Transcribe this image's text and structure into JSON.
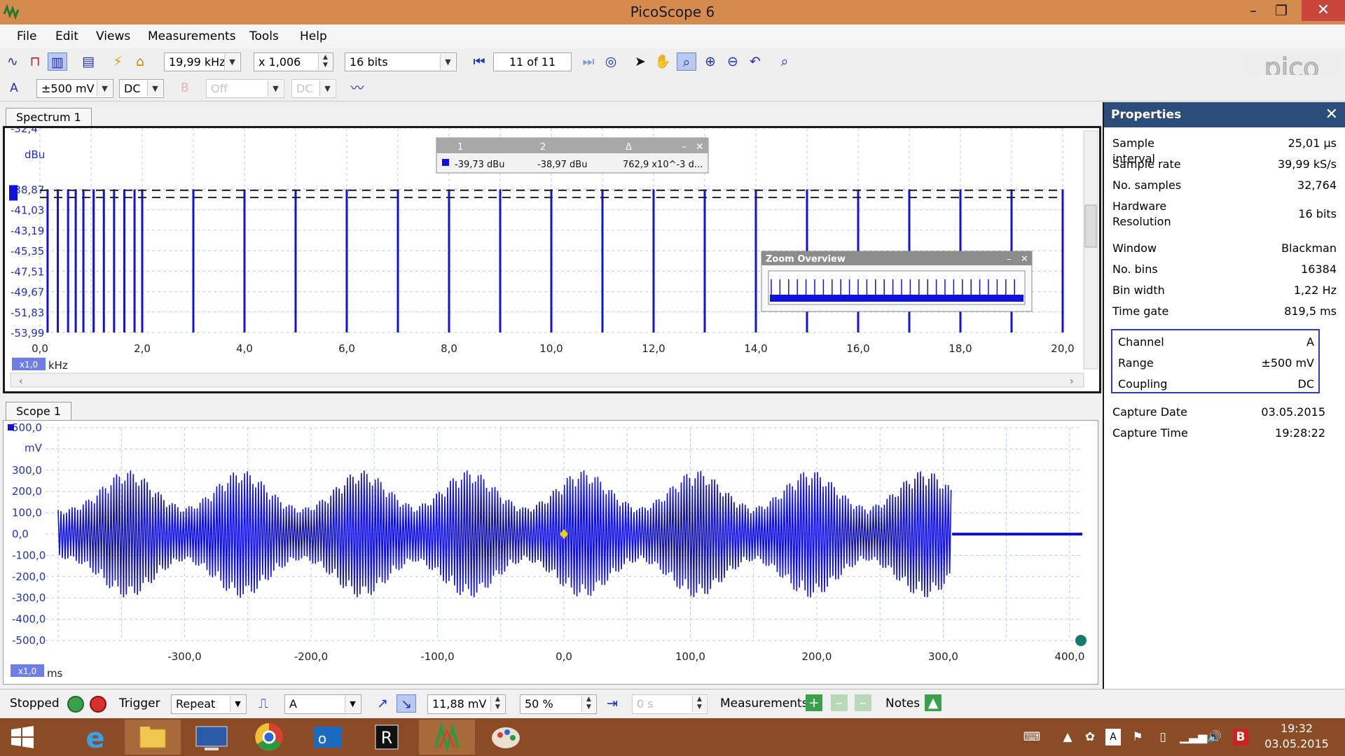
{
  "window": {
    "title": "PicoScope 6"
  },
  "menu": [
    "File",
    "Edit",
    "Views",
    "Measurements",
    "Tools",
    "Help"
  ],
  "toolbar": {
    "freq_range": "19,99 kHz",
    "zoom": "x 1,006",
    "resolution": "16 bits",
    "buffer": "11 of 11"
  },
  "channel_bar": {
    "chan_a": "A",
    "range_a": "±500 mV",
    "coupling_a": "DC",
    "chan_b": "B",
    "range_b": "Off",
    "coupling_b": "DC"
  },
  "spectrum": {
    "tab": "Spectrum 1",
    "y_unit": "dBu",
    "x_unit": "kHz",
    "zoom_label": "x1,0",
    "overview_title": "Zoom Overview",
    "ruler_table": {
      "headers": [
        "1",
        "2",
        "Δ"
      ],
      "values": [
        "-39,73 dBu",
        "-38,97 dBu",
        "762,9 x10^-3 d..."
      ]
    }
  },
  "scope": {
    "tab": "Scope 1",
    "y_unit": "mV",
    "x_unit": "ms",
    "zoom_label": "x1,0"
  },
  "chart_data": [
    {
      "type": "bar",
      "name_tab": "Spectrum 1",
      "y_ticks": [
        "-32,4",
        "-38,87",
        "-41,03",
        "-43,19",
        "-45,35",
        "-47,51",
        "-49,67",
        "-51,83",
        "-53,99"
      ],
      "x_ticks": [
        "0,0",
        "2,0",
        "4,0",
        "6,0",
        "8,0",
        "10,0",
        "12,0",
        "14,0",
        "16,0",
        "18,0",
        "20,0"
      ],
      "ylim": [
        -53.99,
        -32.4
      ],
      "xlim": [
        0,
        20
      ],
      "ylabel": "dBu",
      "xlabel": "kHz",
      "peaks_x": [
        0.15,
        0.35,
        0.55,
        0.7,
        0.85,
        1.05,
        1.25,
        1.45,
        1.65,
        1.85,
        2.0,
        3.0,
        4.0,
        5.0,
        6.0,
        7.0,
        8.0,
        9.0,
        10.0,
        11.0,
        12.0,
        13.0,
        14.0,
        15.0,
        16.0,
        17.0,
        18.0,
        19.0,
        20.0
      ],
      "peak_value": -38.87,
      "rulers_dbu": [
        -39.73,
        -38.97
      ],
      "grid": true
    },
    {
      "type": "line",
      "name_tab": "Scope 1",
      "y_ticks": [
        "500,0",
        "300,0",
        "200,0",
        "100,0",
        "0,0",
        "-100,0",
        "-200,0",
        "-300,0",
        "-400,0",
        "-500,0"
      ],
      "x_ticks": [
        "-300,0",
        "-200,0",
        "-100,0",
        "0,0",
        "100,0",
        "200,0",
        "300,0",
        "400,0"
      ],
      "ylim": [
        -500,
        500
      ],
      "xlim": [
        -410,
        410
      ],
      "ylabel": "mV",
      "xlabel": "ms",
      "envelope_peaks_ms": [
        -345,
        -255,
        -160,
        -75,
        15,
        105,
        195,
        285
      ],
      "signal_end_ms": 307,
      "max_amplitude_mv": 300,
      "trigger_ms": 0,
      "grid": true
    }
  ],
  "properties": {
    "title": "Properties",
    "rows": [
      {
        "k": "Sample interval",
        "v": "25,01 μs"
      },
      {
        "k": "Sample rate",
        "v": "39,99 kS/s"
      },
      {
        "k": "No. samples",
        "v": "32,764"
      },
      {
        "k": "Hardware Resolution",
        "v": "16 bits"
      },
      {
        "k": "Window",
        "v": "Blackman"
      },
      {
        "k": "No. bins",
        "v": "16384"
      },
      {
        "k": "Bin width",
        "v": "1,22 Hz"
      },
      {
        "k": "Time gate",
        "v": "819,5 ms"
      }
    ],
    "channel": [
      {
        "k": "Channel",
        "v": "A"
      },
      {
        "k": "Range",
        "v": "±500 mV"
      },
      {
        "k": "Coupling",
        "v": "DC"
      }
    ],
    "capture": [
      {
        "k": "Capture Date",
        "v": "03.05.2015"
      },
      {
        "k": "Capture Time",
        "v": "19:28:22"
      }
    ]
  },
  "status": {
    "state": "Stopped",
    "trigger_label": "Trigger",
    "trigger_mode": "Repeat",
    "trigger_channel": "A",
    "trigger_level": "11,88 mV",
    "pre_trigger": "50 %",
    "delay": "0 s",
    "measurements_label": "Measurements",
    "notes_label": "Notes"
  },
  "taskbar": {
    "time": "19:32",
    "date": "03.05.2015"
  },
  "colors": {
    "trace": "#1010e0",
    "titlebar": "#d68b4e",
    "taskbar": "#8a4b26",
    "props_header": "#2c4d7a"
  }
}
